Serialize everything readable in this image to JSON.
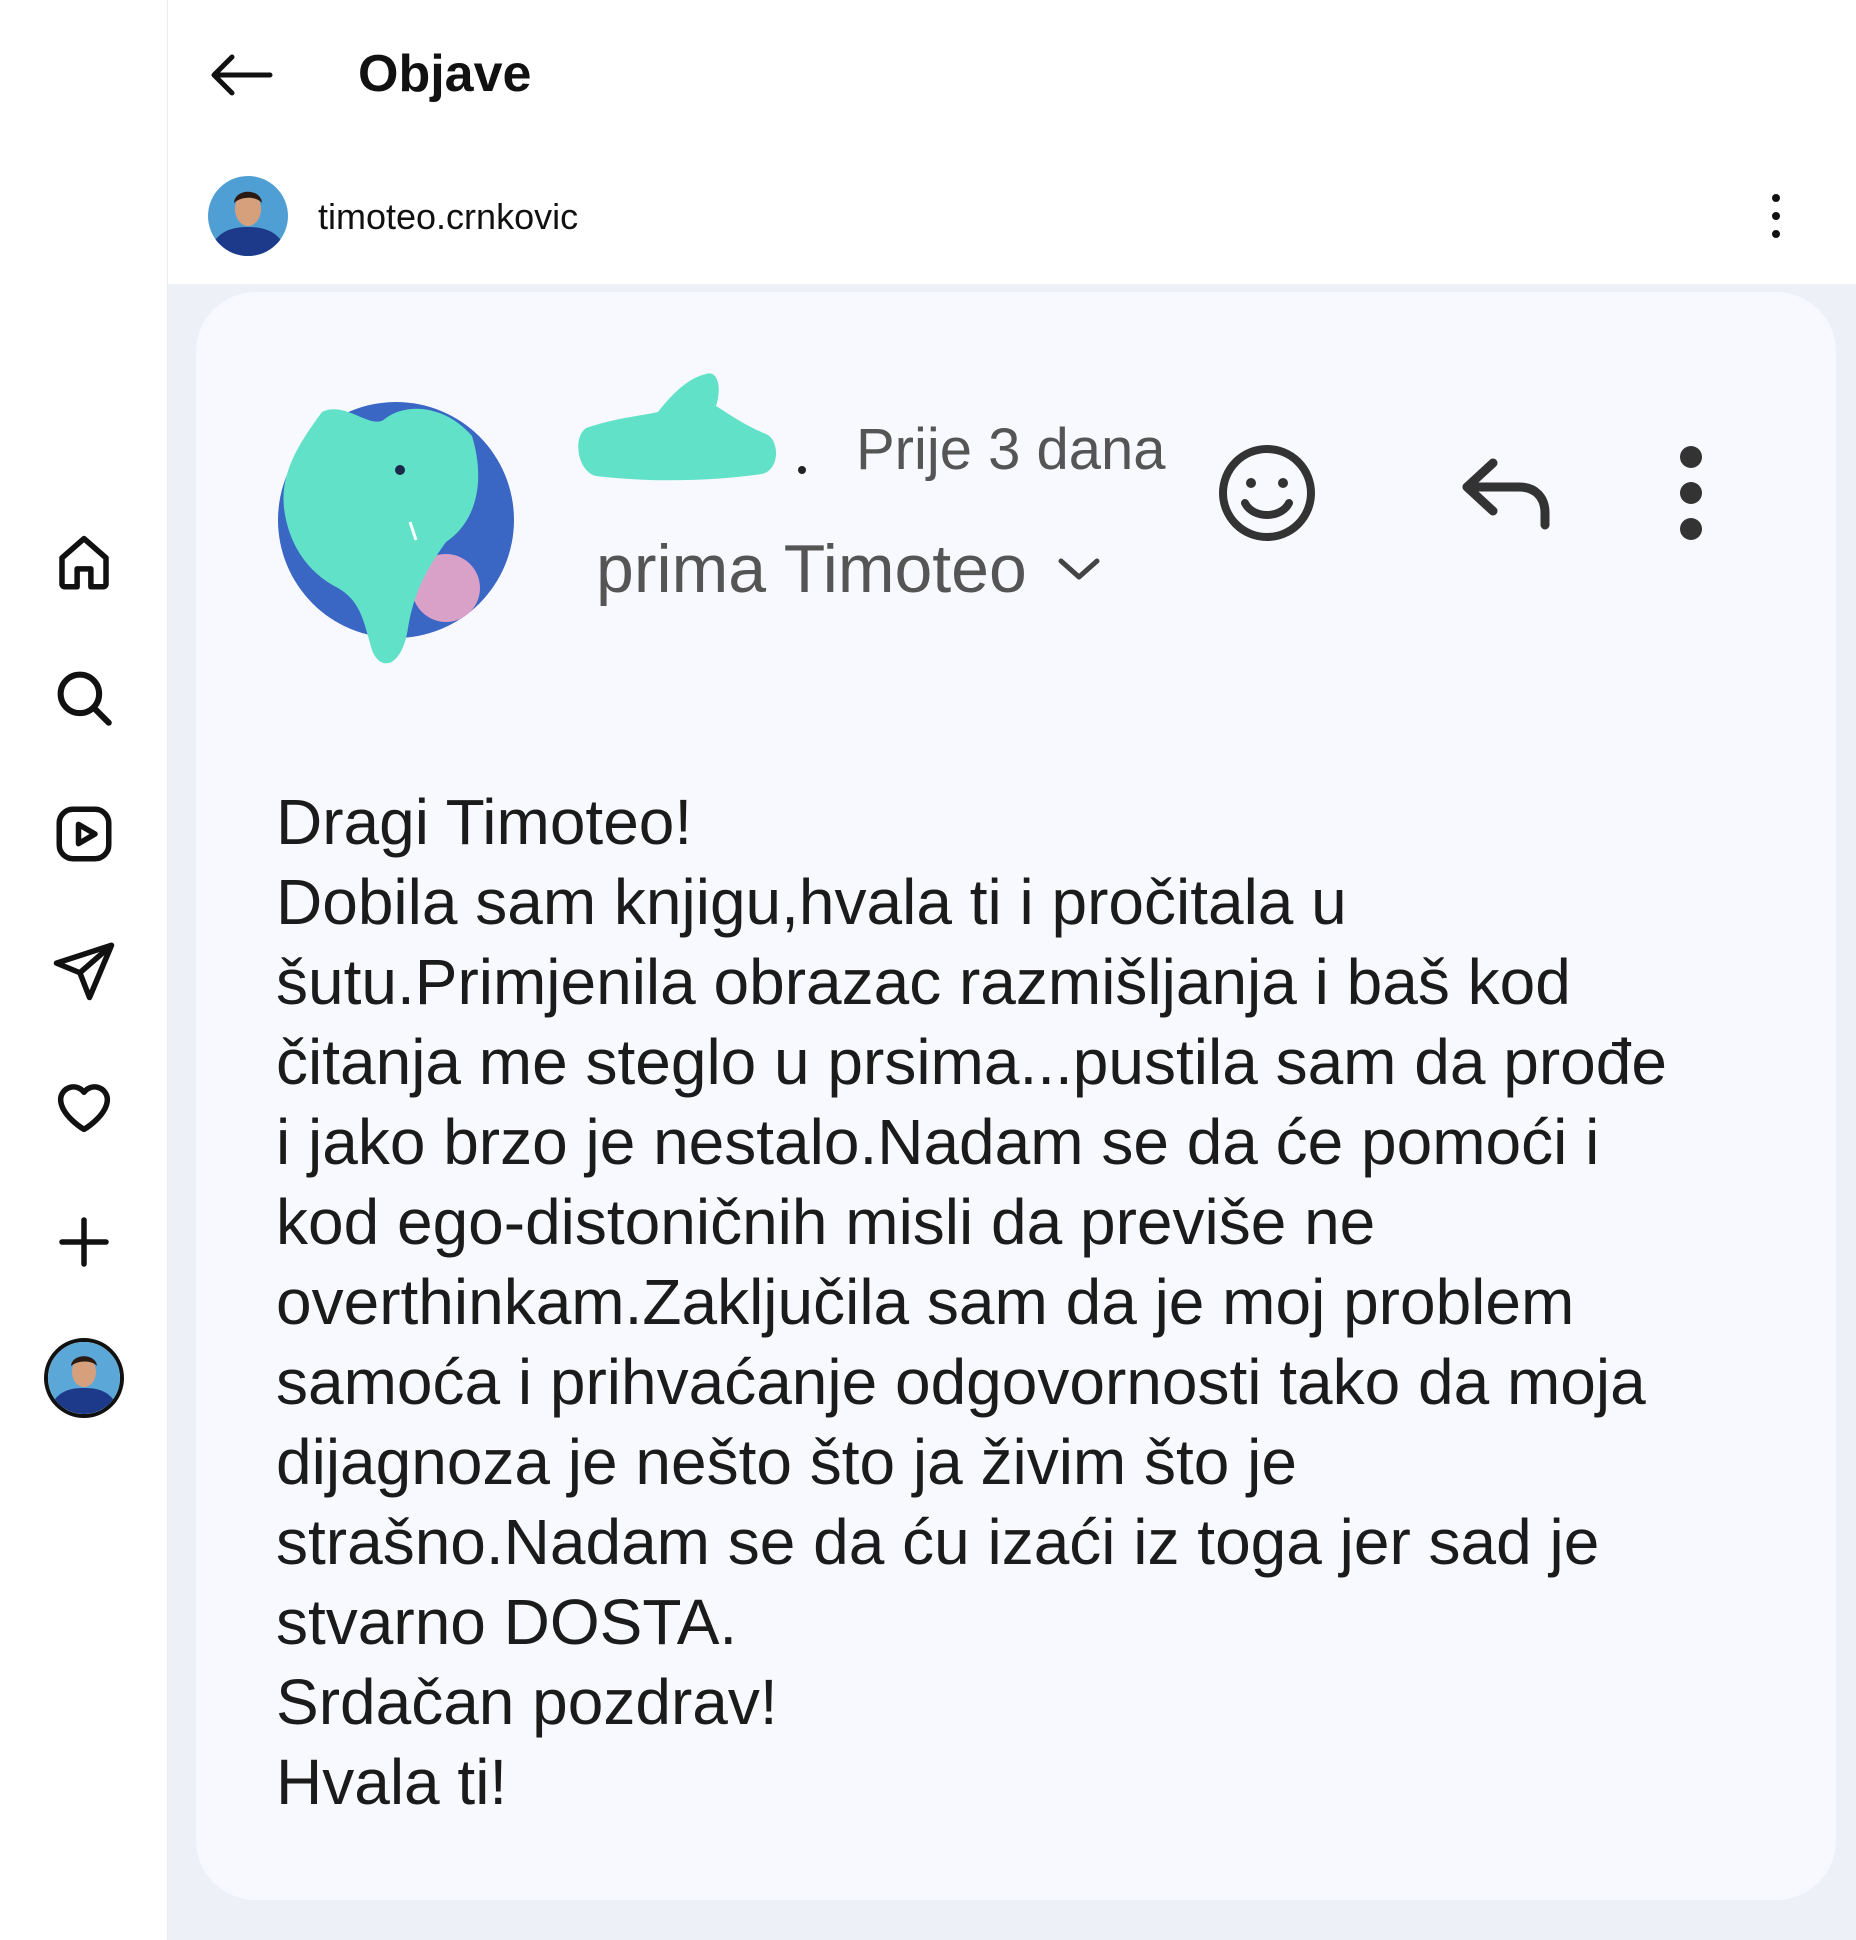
{
  "header": {
    "title": "Objave"
  },
  "post": {
    "username": "timoteo.crnkovic"
  },
  "email": {
    "time_ago": "Prije 3 dana",
    "recipient": "prima Timoteo",
    "body_lines": [
      "Dragi Timoteo!",
      "Dobila sam knjigu,hvala ti i pročitala u",
      "šutu.Primjenila obrazac razmišljanja i baš kod",
      "čitanja me steglo u prsima...pustila sam da prođe",
      "i jako brzo je nestalo.Nadam se da će pomoći i",
      "kod ego-distoničnih misli da previše ne",
      "overthinkam.Zaključila sam da je moj problem",
      "samoća i prihvaćanje odgovornosti tako da moja",
      "dijagnoza je nešto što ja živim što je",
      "strašno.Nadam se da ću izaći iz toga jer sad je",
      "stvarno DOSTA.",
      "Srdačan pozdrav!",
      "Hvala ti!"
    ]
  },
  "nav": {
    "items": [
      "home-icon",
      "search-icon",
      "reels-icon",
      "direct-icon",
      "heart-icon",
      "create-icon",
      "profile-avatar"
    ]
  },
  "colors": {
    "redaction": "#62e1c9",
    "card_bg": "#f8f9fe",
    "post_bg": "#eef0f7"
  }
}
